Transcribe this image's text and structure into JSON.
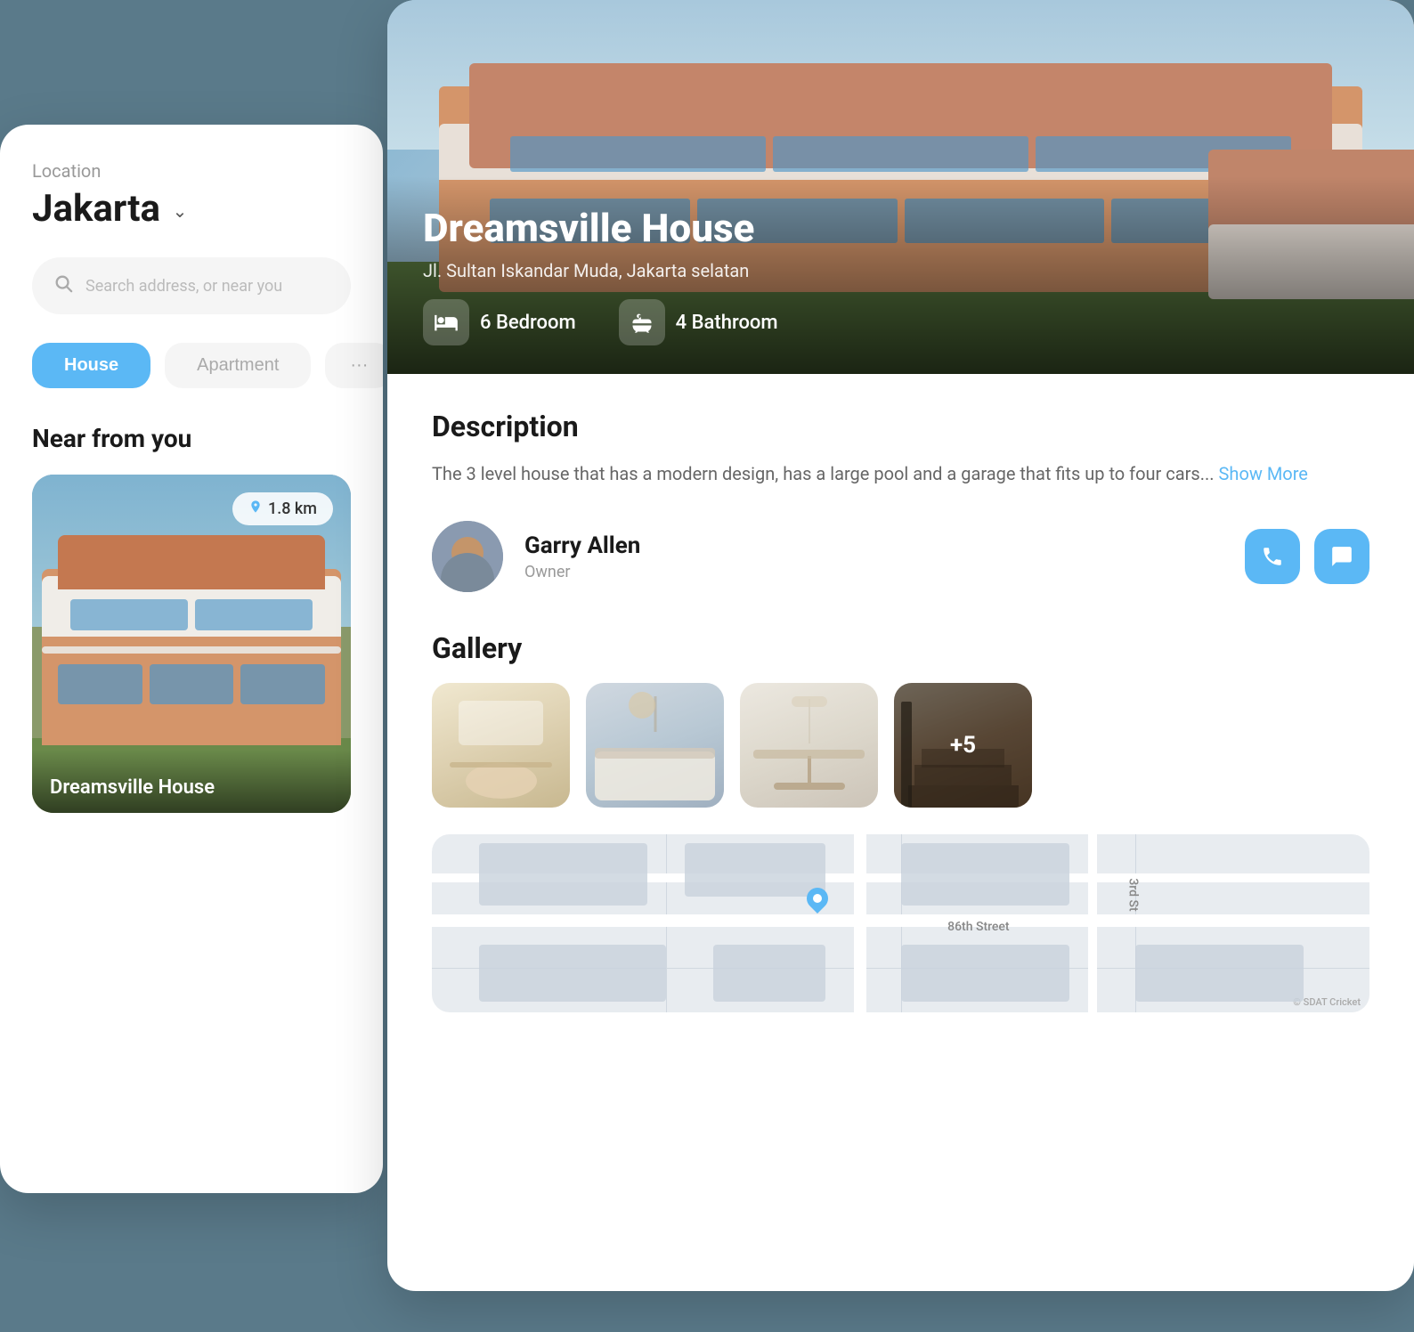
{
  "left_card": {
    "location_label": "Location",
    "city": "Jakarta",
    "search_placeholder": "Search address, or near you",
    "tabs": [
      {
        "label": "House",
        "active": true
      },
      {
        "label": "Apartment",
        "active": false
      },
      {
        "label": "...",
        "active": false
      }
    ],
    "near_section": "Near from you",
    "property": {
      "distance": "1.8 km",
      "title": "Dreamsville House"
    }
  },
  "right_card": {
    "hero": {
      "title": "Dreamsville House",
      "address": "Jl. Sultan Iskandar Muda, Jakarta selatan",
      "features": [
        {
          "icon": "🛏",
          "label": "6 Bedroom"
        },
        {
          "icon": "🛁",
          "label": "4 Bathroom"
        }
      ]
    },
    "description": {
      "title": "Description",
      "text": "The 3 level house that has a modern design, has a large pool and a garage that fits up to four cars...",
      "show_more": "Show More"
    },
    "owner": {
      "name": "Garry Allen",
      "role": "Owner"
    },
    "contact": {
      "phone_label": "📞",
      "chat_label": "💬"
    },
    "gallery": {
      "title": "Gallery",
      "more_count": "+5",
      "items": [
        {
          "type": "living",
          "alt": "Living room"
        },
        {
          "type": "bedroom",
          "alt": "Bedroom"
        },
        {
          "type": "dining",
          "alt": "Dining room"
        },
        {
          "type": "stairs",
          "alt": "Stairs"
        }
      ]
    }
  },
  "icons": {
    "chevron_down": "⌄",
    "search": "🔍",
    "pin": "📍"
  }
}
